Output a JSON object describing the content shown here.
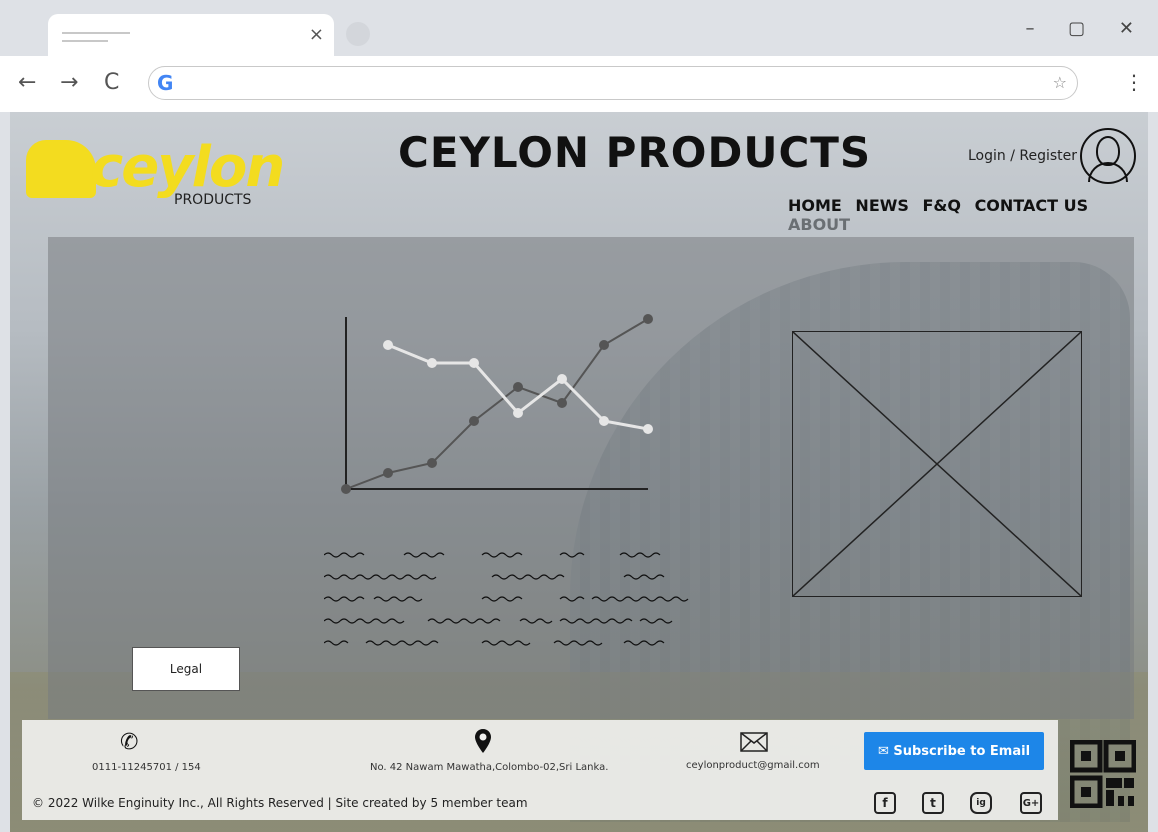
{
  "browser": {
    "tab_close": "×",
    "controls": "–  ▢  ✕",
    "back": "←",
    "forward": "→",
    "reload": "C",
    "omnibox_logo": "G",
    "star": "☆",
    "menu": "⋮"
  },
  "header": {
    "logo_text": "ceylon",
    "logo_sub": "PRODUCTS",
    "title": "CEYLON PRODUCTS",
    "login": "Login / Register"
  },
  "nav": {
    "items": [
      "HOME",
      "NEWS",
      "F&Q",
      "CONTACT US",
      "ABOUT"
    ]
  },
  "main": {
    "legal_button": "Legal"
  },
  "footer": {
    "phone": "0111-11245701 / 154",
    "address": "No. 42 Nawam Mawatha,Colombo-02,Sri Lanka.",
    "email": "ceylonproduct@gmail.com",
    "subscribe": "✉ Subscribe to Email",
    "copyright": "© 2022 Wilke Enginuity Inc., All Rights Reserved | Site created by 5 member team",
    "social": [
      "f",
      "t",
      "ig",
      "G+"
    ]
  },
  "colors": {
    "brand_yellow": "#f3dc1f",
    "subscribe_blue": "#1d86e8"
  }
}
